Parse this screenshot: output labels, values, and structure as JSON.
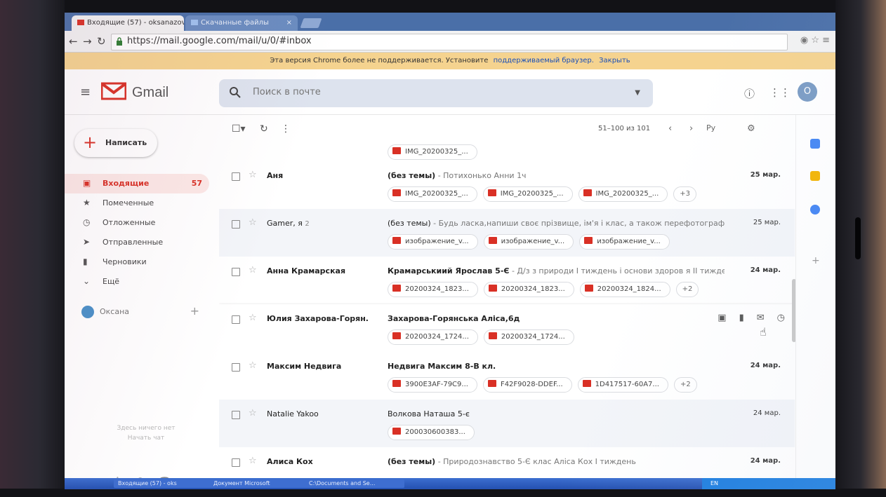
{
  "browser": {
    "tabs": [
      {
        "label": "Входящие (57) - oksanazov",
        "close": "×"
      },
      {
        "label": "Скачанные файлы",
        "close": "×"
      }
    ],
    "url": "https://mail.google.com/mail/u/0/#inbox",
    "banner": {
      "text": "Эта версия Chrome более не поддерживается. Установите",
      "link": "поддерживаемый браузер.",
      "dismiss": "Закрыть"
    }
  },
  "header": {
    "logo_text": "Gmail",
    "search_placeholder": "Поиск в почте",
    "avatar_letter": "О"
  },
  "sidebar": {
    "compose_label": "Написать",
    "items": [
      {
        "label": "Входящие",
        "count": "57",
        "icon": "inbox-icon"
      },
      {
        "label": "Помеченные",
        "count": "",
        "icon": "star-icon"
      },
      {
        "label": "Отложенные",
        "count": "",
        "icon": "clock-icon"
      },
      {
        "label": "Отправленные",
        "count": "",
        "icon": "send-icon"
      },
      {
        "label": "Черновики",
        "count": "",
        "icon": "draft-icon"
      },
      {
        "label": "Ещё",
        "count": "",
        "icon": "chevron-down-icon"
      }
    ],
    "user_name": "Оксана",
    "chat_empty_line1": "Здесь ничего нет",
    "chat_empty_line2": "Начать чат"
  },
  "toolbar": {
    "pager_text": "51–100 из 101",
    "lang": "Ру"
  },
  "emails": [
    {
      "sender": "",
      "count": "",
      "subject": "",
      "snippet": "",
      "date": "",
      "unread": false,
      "attachments": [
        "IMG_20200325_..."
      ],
      "more": ""
    },
    {
      "sender": "Аня",
      "count": "",
      "subject": "(без темы)",
      "snippet": " - Потихонько Анни 1ч",
      "date": "25 мар.",
      "unread": true,
      "attachments": [
        "IMG_20200325_...",
        "IMG_20200325_...",
        "IMG_20200325_..."
      ],
      "more": "+3"
    },
    {
      "sender": "Gamer, я",
      "count": "2",
      "subject": "(без темы)",
      "snippet": " - Будь ласка,напиши своє прізвище, ім'я і клас, а також перефотографу...",
      "date": "25 мар.",
      "unread": false,
      "attachments": [
        "изображение_v...",
        "изображение_v...",
        "изображение_v..."
      ],
      "more": ""
    },
    {
      "sender": "Анна Крамарская",
      "count": "",
      "subject": "Крамарськиий Ярослав 5-Є",
      "snippet": " - Д/з з природи І тиждень і основи здоров я ІІ тиждень ...",
      "date": "24 мар.",
      "unread": true,
      "attachments": [
        "20200324_1823...",
        "20200324_1823...",
        "20200324_1824..."
      ],
      "more": "+2"
    },
    {
      "sender": "Юлия Захарова-Горян.",
      "count": "",
      "subject": "Захарова-Горянська Аліса,6д",
      "snippet": "",
      "date": "",
      "unread": true,
      "attachments": [
        "20200324_1724...",
        "20200324_1724..."
      ],
      "more": "",
      "hover": true
    },
    {
      "sender": "Максим Недвига",
      "count": "",
      "subject": "Недвига Максим 8-В кл.",
      "snippet": "",
      "date": "24 мар.",
      "unread": true,
      "attachments": [
        "3900E3AF-79C9...",
        "F42F9028-DDEF...",
        "1D417517-60A7..."
      ],
      "more": "+2"
    },
    {
      "sender": "Natalie Yakoo",
      "count": "",
      "subject": "Волкова Наташа 5-є",
      "snippet": "",
      "date": "24 мар.",
      "unread": false,
      "attachments": [
        "200030600383..."
      ],
      "more": ""
    },
    {
      "sender": "Алиса Кох",
      "count": "",
      "subject": "(без темы)",
      "snippet": " - Природознавство 5-Є клас Аліса Кох І тиждень",
      "date": "24 мар.",
      "unread": true,
      "attachments": [],
      "more": ""
    }
  ],
  "taskbar": {
    "items": [
      "Входящие (57) - oks",
      "Документ Microsoft",
      "C:\\Documents and Se..."
    ],
    "lang": "EN"
  },
  "colors": {
    "accent": "#d93025",
    "tabbar": "#4a6fa8",
    "banner": "#f5d38f",
    "search": "#dde3ee"
  }
}
